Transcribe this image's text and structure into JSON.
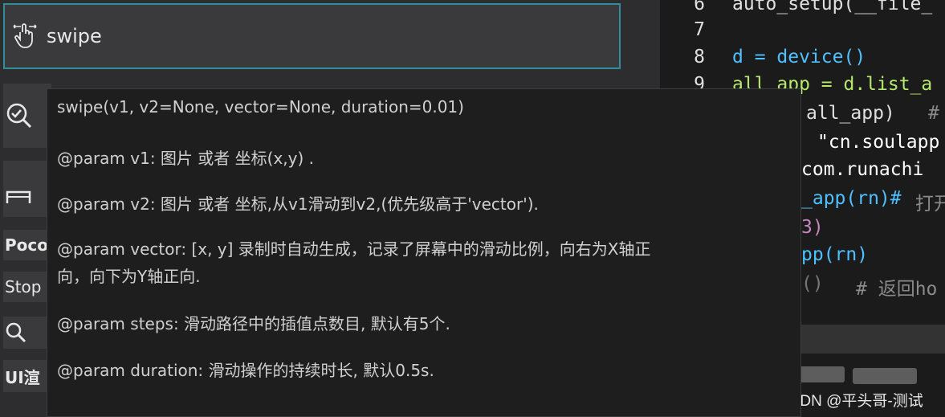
{
  "left_panel": {
    "swipe_button": {
      "label": "swipe",
      "icon": "touch-swipe-icon"
    },
    "side_items": [
      {
        "text": "",
        "icon": "search-check-icon"
      },
      {
        "text": "",
        "icon": "window-icon"
      },
      {
        "text": "Poco"
      },
      {
        "text": "Stop"
      },
      {
        "text": "",
        "icon": "search-icon"
      },
      {
        "text": "UI渲"
      }
    ]
  },
  "editor": {
    "lines": [
      {
        "num": "6",
        "code": "auto_setup(__file_"
      },
      {
        "num": "7",
        "code": ""
      },
      {
        "num": "8",
        "code": "d = device()"
      },
      {
        "num": "9",
        "code": "all_app = d.list_a"
      },
      {
        "code_a": "all_app)",
        "code_b": "#"
      },
      {
        "code_a": "\"cn.soulapp"
      },
      {
        "code_a": "com.runachi"
      },
      {
        "code_a": "_app(rn)#",
        "code_b": "打开"
      },
      {
        "code_a": "3)"
      },
      {
        "code_a": "pp(rn)"
      },
      {
        "code_a": "()",
        "code_b": "# 返回ho"
      }
    ]
  },
  "tooltip": {
    "lines": [
      "swipe(v1, v2=None, vector=None, duration=0.01)",
      "@param v1: 图片 或者 坐标(x,y) .",
      "@param v2: 图片 或者 坐标,从v1滑动到v2,(优先级高于'vector').",
      "@param vector: [x, y] 录制时自动生成，记录了屏幕中的滑动比例，向右为X轴正",
      "向，向下为Y轴正向.",
      "@param steps: 滑动路径中的插值点数目, 默认有5个.",
      "@param duration: 滑动操作的持续时长, 默认0.5s."
    ]
  },
  "watermark": "CSDN @平头哥-测试"
}
